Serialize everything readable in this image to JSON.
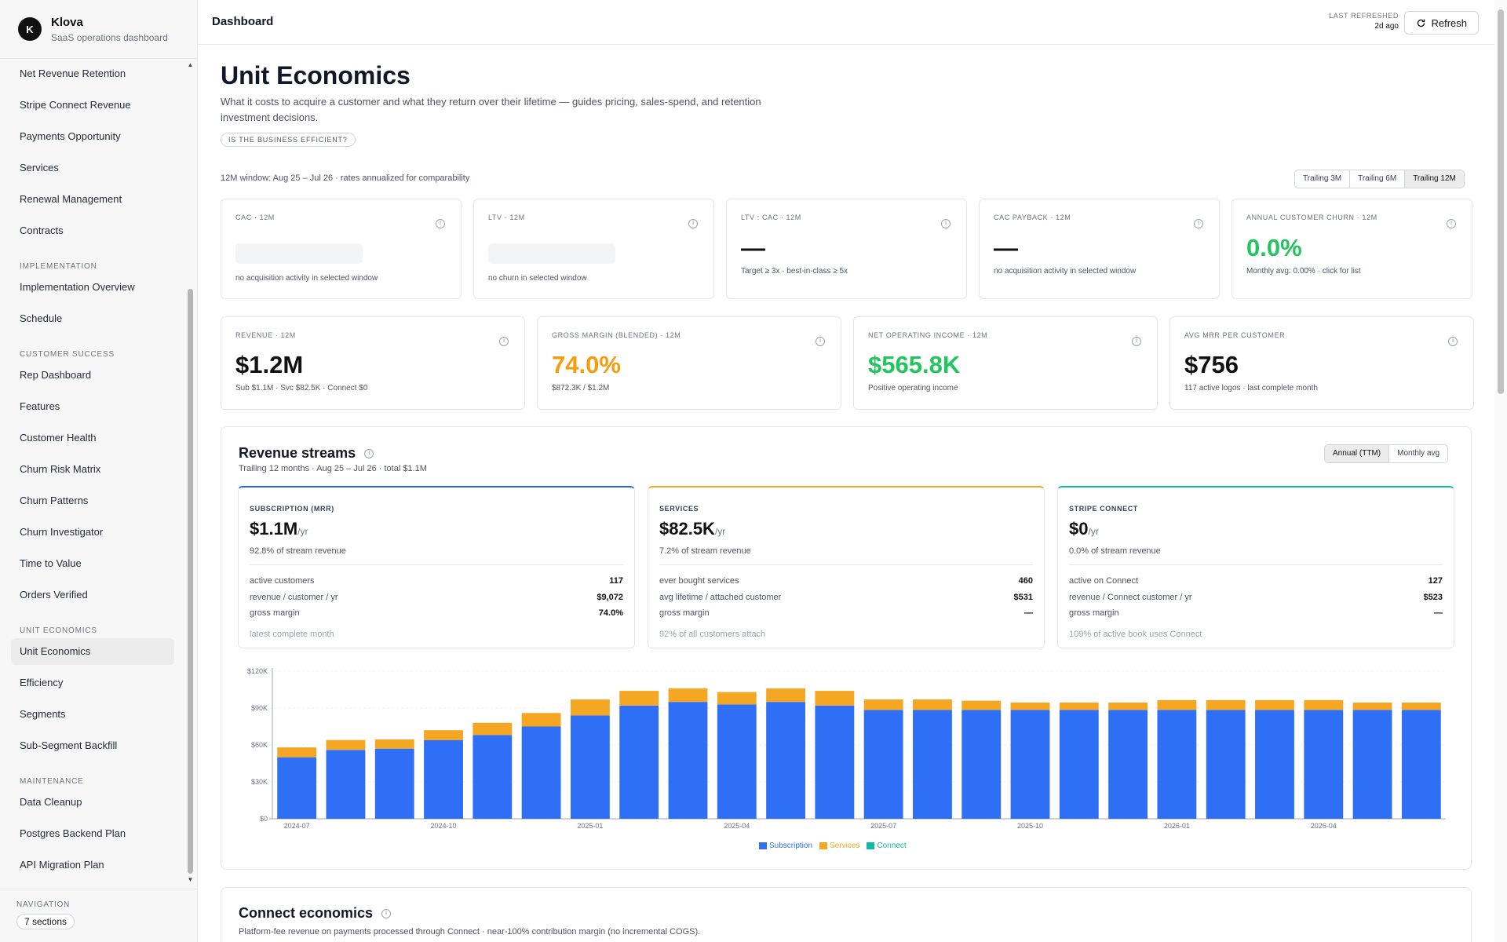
{
  "brand": {
    "logo_letter": "K",
    "name": "Klova",
    "subtitle": "SaaS operations dashboard"
  },
  "sidebar": {
    "items": [
      {
        "label": "Net Revenue Retention"
      },
      {
        "label": "Stripe Connect Revenue"
      },
      {
        "label": "Payments Opportunity"
      },
      {
        "label": "Services"
      },
      {
        "label": "Renewal Management"
      },
      {
        "label": "Contracts"
      },
      {
        "section": "IMPLEMENTATION"
      },
      {
        "label": "Implementation Overview"
      },
      {
        "label": "Schedule"
      },
      {
        "section": "CUSTOMER SUCCESS"
      },
      {
        "label": "Rep Dashboard"
      },
      {
        "label": "Features"
      },
      {
        "label": "Customer Health"
      },
      {
        "label": "Churn Risk Matrix"
      },
      {
        "label": "Churn Patterns"
      },
      {
        "label": "Churn Investigator"
      },
      {
        "label": "Time to Value"
      },
      {
        "label": "Orders Verified"
      },
      {
        "section": "UNIT ECONOMICS"
      },
      {
        "label": "Unit Economics",
        "active": true
      },
      {
        "label": "Efficiency"
      },
      {
        "label": "Segments"
      },
      {
        "label": "Sub-Segment Backfill"
      },
      {
        "section": "MAINTENANCE"
      },
      {
        "label": "Data Cleanup"
      },
      {
        "label": "Postgres Backend Plan"
      },
      {
        "label": "API Migration Plan"
      }
    ],
    "footer_label": "NAVIGATION",
    "footer_pill": "7 sections"
  },
  "topbar": {
    "title": "Dashboard",
    "refreshed_label": "LAST REFRESHED",
    "refreshed_time": "2d ago",
    "refresh_button": "Refresh"
  },
  "page": {
    "title": "Unit Economics",
    "description": "What it costs to acquire a customer and what they return over their lifetime — guides pricing, sales-spend, and retention investment decisions.",
    "tag": "IS THE BUSINESS EFFICIENT?",
    "window_note": "12M window: Aug 25 – Jul 26 · rates annualized for comparability",
    "ranges": [
      {
        "label": "Trailing 3M",
        "selected": false
      },
      {
        "label": "Trailing 6M",
        "selected": false
      },
      {
        "label": "Trailing 12M",
        "selected": true
      }
    ]
  },
  "kpis_row1": [
    {
      "label": "CAC · 12M",
      "value": "",
      "loading": true,
      "sub": "no acquisition activity in selected window"
    },
    {
      "label": "LTV · 12M",
      "value": "",
      "loading": true,
      "sub": "no churn in selected window"
    },
    {
      "label": "LTV : CAC · 12M",
      "value": "—",
      "sub": "Target ≥ 3x · best-in-class ≥ 5x"
    },
    {
      "label": "CAC PAYBACK · 12M",
      "value": "—",
      "sub": "no acquisition activity in selected window"
    },
    {
      "label": "ANNUAL CUSTOMER CHURN · 12M",
      "value": "0.0%",
      "color": "#22c55e",
      "sub": "Monthly avg: 0.00% · click for list"
    }
  ],
  "kpis_row2": [
    {
      "label": "REVENUE · 12M",
      "value": "$1.2M",
      "sub": "Sub $1.1M · Svc $82.5K · Connect $0"
    },
    {
      "label": "GROSS MARGIN (BLENDED) · 12M",
      "value": "74.0%",
      "color": "#f59e0b",
      "sub": "$872.3K / $1.2M"
    },
    {
      "label": "NET OPERATING INCOME · 12M",
      "value": "$565.8K",
      "color": "#22c55e",
      "sub": "Positive operating income"
    },
    {
      "label": "AVG MRR PER CUSTOMER",
      "value": "$756",
      "sub": "117 active logos · last complete month"
    }
  ],
  "revenue_streams": {
    "title": "Revenue streams",
    "subtitle": "Trailing 12 months · Aug 25 – Jul 26 · total $1.1M",
    "toggle": [
      {
        "label": "Annual (TTM)",
        "selected": true
      },
      {
        "label": "Monthly avg",
        "selected": false
      }
    ],
    "streams": [
      {
        "label": "SUBSCRIPTION (MRR)",
        "value": "$1.1M",
        "unit": "/yr",
        "pct": "92.8% of stream revenue",
        "accent": "#2563eb",
        "rows": [
          {
            "k": "active customers",
            "v": "117"
          },
          {
            "k": "revenue / customer / yr",
            "v": "$9,072"
          },
          {
            "k": "gross margin",
            "v": "74.0%"
          }
        ],
        "foot": "latest complete month"
      },
      {
        "label": "SERVICES",
        "value": "$82.5K",
        "unit": "/yr",
        "pct": "7.2% of stream revenue",
        "accent": "#f5a623",
        "rows": [
          {
            "k": "ever bought services",
            "v": "460"
          },
          {
            "k": "avg lifetime / attached customer",
            "v": "$531"
          },
          {
            "k": "gross margin",
            "v": "—"
          }
        ],
        "foot": "92% of all customers attach"
      },
      {
        "label": "STRIPE CONNECT",
        "value": "$0",
        "unit": "/yr",
        "pct": "0.0% of stream revenue",
        "accent": "#14b8a6",
        "rows": [
          {
            "k": "active on Connect",
            "v": "127"
          },
          {
            "k": "revenue / Connect customer / yr",
            "v": "$523"
          },
          {
            "k": "gross margin",
            "v": "—"
          }
        ],
        "foot": "109% of active book uses Connect"
      }
    ]
  },
  "chart_data": {
    "type": "bar",
    "stacked": true,
    "categories": [
      "2024-07",
      "2024-08",
      "2024-09",
      "2024-10",
      "2024-11",
      "2024-12",
      "2025-01",
      "2025-02",
      "2025-03",
      "2025-04",
      "2025-05",
      "2025-06",
      "2025-07",
      "2025-08",
      "2025-09",
      "2025-10",
      "2025-11",
      "2025-12",
      "2026-01",
      "2026-02",
      "2026-03",
      "2026-04",
      "2026-05",
      "2026-06"
    ],
    "x_tick_labels": [
      "2024-07",
      "2024-10",
      "2025-01",
      "2025-04",
      "2025-07",
      "2025-10",
      "2026-01",
      "2026-04"
    ],
    "y_tick_labels": [
      "$0",
      "$30K",
      "$60K",
      "$90K",
      "$120K"
    ],
    "ylim": [
      0,
      120000
    ],
    "grid": true,
    "legend_position": "bottom",
    "series": [
      {
        "name": "Subscription",
        "color": "#2f6ff5",
        "values": [
          50000,
          56000,
          57000,
          64000,
          68000,
          75000,
          84000,
          92000,
          95000,
          93000,
          95000,
          92000,
          88500,
          88500,
          88500,
          88500,
          88500,
          88500,
          88500,
          88500,
          88500,
          88500,
          88500,
          88500
        ]
      },
      {
        "name": "Services",
        "color": "#f5a623",
        "values": [
          8000,
          8000,
          7500,
          8000,
          10000,
          11000,
          13000,
          12000,
          11000,
          10000,
          11000,
          12000,
          8500,
          8500,
          7500,
          6000,
          6000,
          6000,
          8000,
          8000,
          8000,
          8000,
          6000,
          6000
        ]
      },
      {
        "name": "Connect",
        "color": "#14b8a6",
        "values": [
          0,
          0,
          0,
          0,
          0,
          0,
          0,
          0,
          0,
          0,
          0,
          0,
          0,
          0,
          0,
          0,
          0,
          0,
          0,
          0,
          0,
          0,
          0,
          0
        ]
      }
    ]
  },
  "connect_economics": {
    "title": "Connect economics",
    "subtitle": "Platform-fee revenue on payments processed through Connect · near-100% contribution margin (no incremental COGS)."
  }
}
